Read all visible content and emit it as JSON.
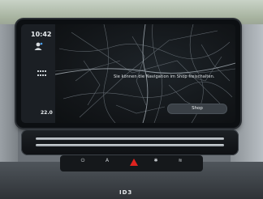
{
  "status": {
    "clock": "10:42",
    "temperature": "22.0"
  },
  "navigation": {
    "message": "Sie können die Navigation im Shop freischalten.",
    "shop_button": "Shop"
  },
  "console": {
    "buttons": [
      {
        "icon": "power-icon",
        "glyph": "⏻"
      },
      {
        "icon": "auto-icon",
        "glyph": "A"
      },
      {
        "icon": "hazard-icon",
        "glyph": ""
      },
      {
        "icon": "heated-front-icon",
        "glyph": "✱"
      },
      {
        "icon": "heated-rear-icon",
        "glyph": "≋"
      }
    ],
    "model_badge": "ID3"
  },
  "colors": {
    "hazard": "#e0231f",
    "screen": "#101316",
    "button": "#3a4046"
  }
}
